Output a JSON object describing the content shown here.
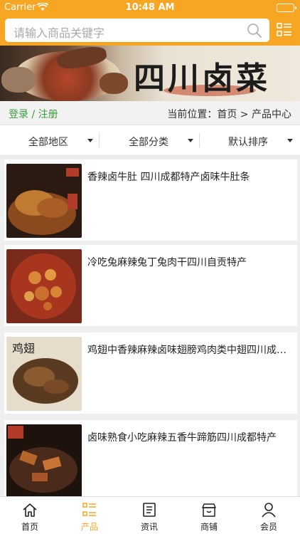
{
  "status": {
    "carrier": "Carrier",
    "time": "10:48 AM",
    "battery_level": 1.0
  },
  "search": {
    "placeholder": "请输入商品关键字",
    "icon": "search-icon",
    "menu_icon": "grid-list-icon"
  },
  "banner": {
    "title": "四川卤菜"
  },
  "crumb": {
    "login": "登录 / 注册",
    "location": "当前位置：首页 > 产品中心"
  },
  "filters": [
    {
      "label": "全部地区"
    },
    {
      "label": "全部分类"
    },
    {
      "label": "默认排序"
    }
  ],
  "products": [
    {
      "name": "香辣卤牛肚 四川成都特产卤味牛肚条"
    },
    {
      "name": "冷吃兔麻辣兔丁兔肉干四川自贡特产"
    },
    {
      "name": "鸡翅中香辣麻辣卤味翅膀鸡肉类中翅四川成都特产"
    },
    {
      "name": "卤味熟食小吃麻辣五香牛蹄筋四川成都特产"
    }
  ],
  "tabs": [
    {
      "label": "首页",
      "icon": "home-icon"
    },
    {
      "label": "产品",
      "icon": "product-list-icon"
    },
    {
      "label": "资讯",
      "icon": "news-icon"
    },
    {
      "label": "商铺",
      "icon": "shop-icon"
    },
    {
      "label": "会员",
      "icon": "member-icon"
    }
  ],
  "colors": {
    "accent": "#f6a623",
    "login_green": "#3b9c3b",
    "background": "#efefef"
  }
}
